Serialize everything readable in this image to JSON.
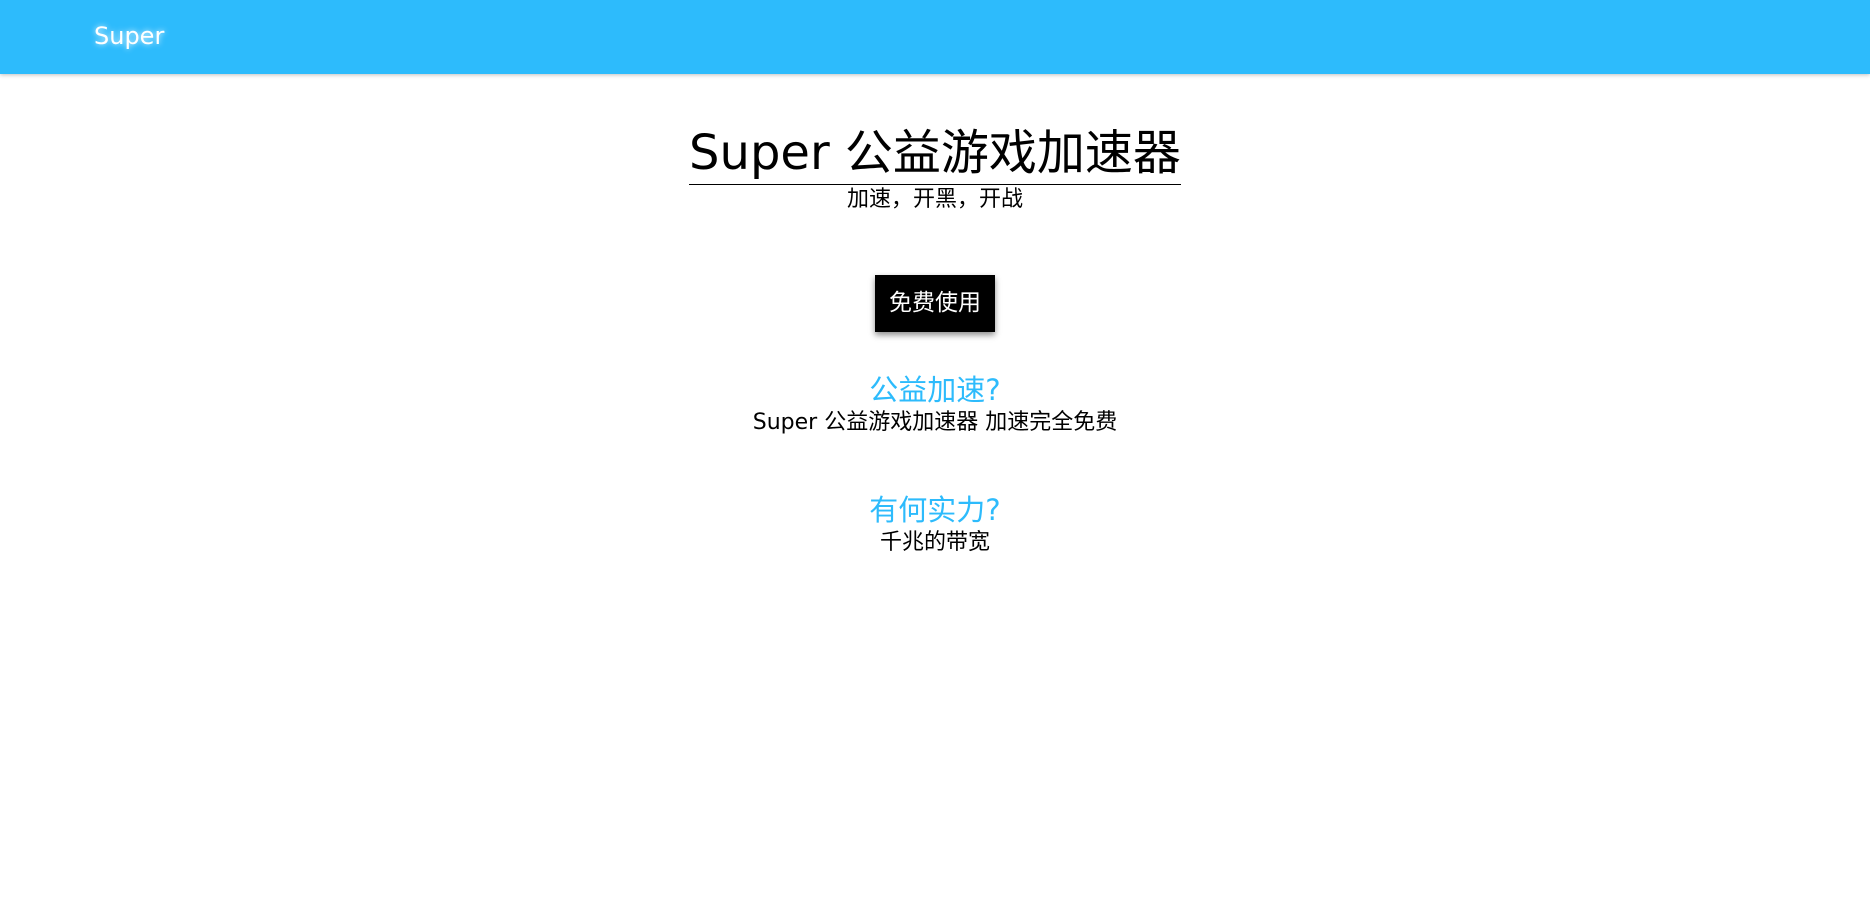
{
  "navbar": {
    "brand": "Super",
    "color": "#2dbbfc"
  },
  "hero": {
    "title": "Super 公益游戏加速器",
    "subtitle": "加速，开黑，开战"
  },
  "cta": {
    "label": "免费使用"
  },
  "features": [
    {
      "title": "公益加速?",
      "description": "Super 公益游戏加速器 加速完全免费"
    },
    {
      "title": "有何实力?",
      "description": "千兆的带宽"
    }
  ],
  "colors": {
    "accent": "#2dbbfc",
    "button_bg": "#000000",
    "button_text": "#ffffff"
  }
}
